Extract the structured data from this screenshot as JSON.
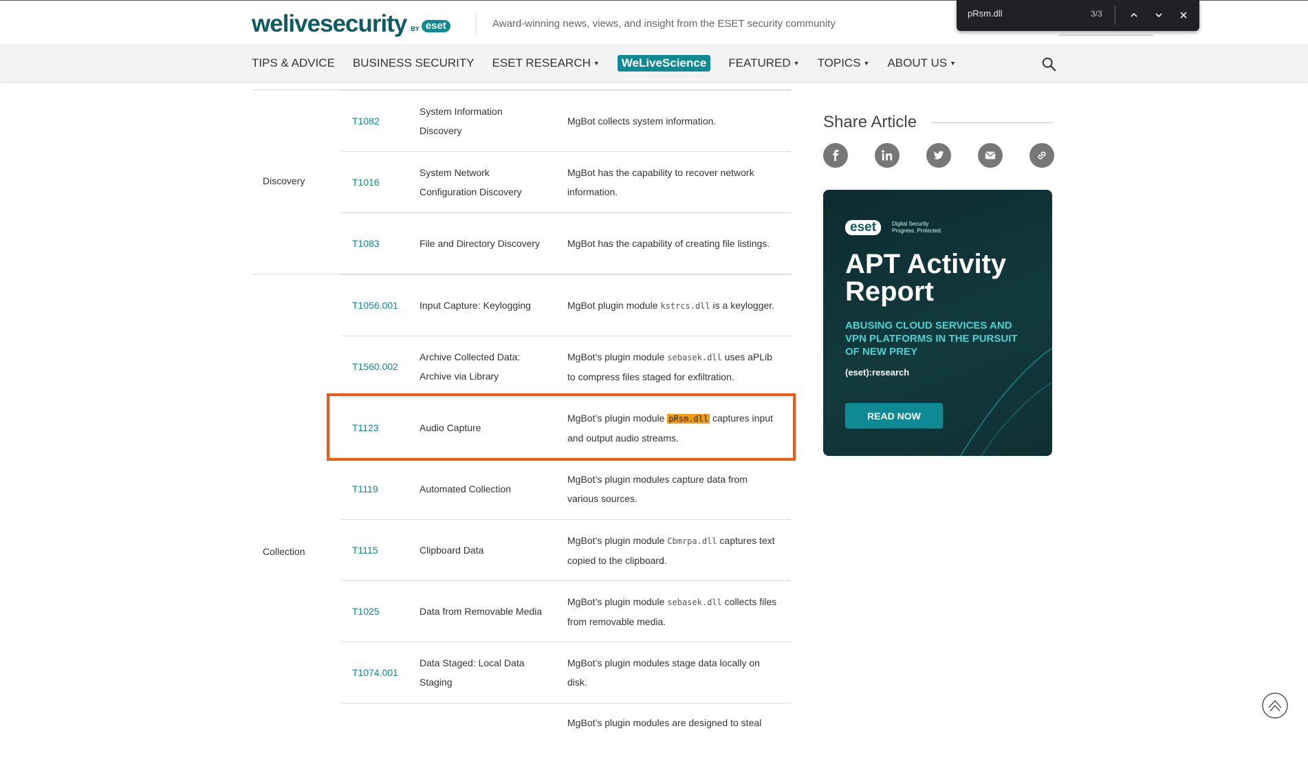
{
  "header": {
    "logo_main": "welivesecurity",
    "logo_by": "BY",
    "logo_eset": "eset",
    "tagline": "Award-winning news, views, and insight from the ESET security community"
  },
  "nav": {
    "items": [
      {
        "label": "TIPS & ADVICE",
        "dropdown": false
      },
      {
        "label": "BUSINESS SECURITY",
        "dropdown": false
      },
      {
        "label": "ESET RESEARCH",
        "dropdown": true
      },
      {
        "label": "WeLiveScience",
        "dropdown": false,
        "highlight": true
      },
      {
        "label": "FEATURED",
        "dropdown": true
      },
      {
        "label": "TOPICS",
        "dropdown": true
      },
      {
        "label": "ABOUT US",
        "dropdown": true
      }
    ],
    "search_icon": "search-icon"
  },
  "findbar": {
    "query": "pRsm.dll",
    "count": "3/3"
  },
  "table": {
    "discovery": {
      "tactic": "Discovery",
      "rows": [
        {
          "id": "T1082",
          "technique": "System Information Discovery",
          "proc": "MgBot collects system information."
        },
        {
          "id": "T1016",
          "technique": "System Network Configuration Discovery",
          "proc": "MgBot has the capability to recover network information."
        },
        {
          "id": "T1083",
          "technique": "File and Directory Discovery",
          "proc": "MgBot has the capability of creating file listings."
        }
      ]
    },
    "collection": {
      "tactic": "Collection",
      "rows": [
        {
          "id": "T1056.001",
          "technique": "Input Capture: Keylogging",
          "proc_pre": "MgBot plugin module ",
          "proc_code": "kstrcs.dll",
          "proc_post": " is a keylogger."
        },
        {
          "id": "T1560.002",
          "technique": "Archive Collected Data: Archive via Library",
          "proc_pre": "MgBot’s plugin module ",
          "proc_code": "sebasek.dll",
          "proc_post": " uses aPLib to compress files staged for exfiltration."
        },
        {
          "id": "T1123",
          "technique": "Audio Capture",
          "proc_pre": "MgBot’s plugin module ",
          "proc_code": "pRsm.dll",
          "proc_post": "  captures input and output audio streams."
        },
        {
          "id": "T1119",
          "technique": "Automated Collection",
          "proc": "MgBot’s plugin modules capture data from various sources."
        },
        {
          "id": "T1115",
          "technique": "Clipboard Data",
          "proc_pre": "MgBot’s plugin module ",
          "proc_code": "Cbmrpa.dll",
          "proc_post": "  captures text copied to the clipboard."
        },
        {
          "id": "T1025",
          "technique": "Data from Removable Media",
          "proc_pre": "MgBot’s plugin module ",
          "proc_code": "sebasek.dll",
          "proc_post": " collects files from removable media."
        },
        {
          "id": "T1074.001",
          "technique": "Data Staged: Local Data Staging",
          "proc": "MgBot’s plugin modules stage data locally on disk."
        },
        {
          "id": "",
          "technique": "",
          "proc": "MgBot’s plugin modules are designed to steal"
        }
      ]
    }
  },
  "sidebar": {
    "share_title": "Share Article",
    "share_icons": [
      "facebook-icon",
      "linkedin-icon",
      "twitter-icon",
      "email-icon",
      "link-icon"
    ],
    "ad": {
      "brand": "eset",
      "brand_line1": "Digital Security",
      "brand_line2": "Progress. Protected.",
      "title": "APT Activity Report",
      "subtitle": "ABUSING CLOUD SERVICES AND VPN PLATFORMS IN THE PURSUIT OF NEW PREY",
      "research": "(eset):research",
      "cta": "READ NOW"
    }
  },
  "colors": {
    "accent": "#0d8a94",
    "brand_dark": "#0d5c63",
    "find_highlight": "#f39c12",
    "annotation_box": "#f05a14"
  }
}
